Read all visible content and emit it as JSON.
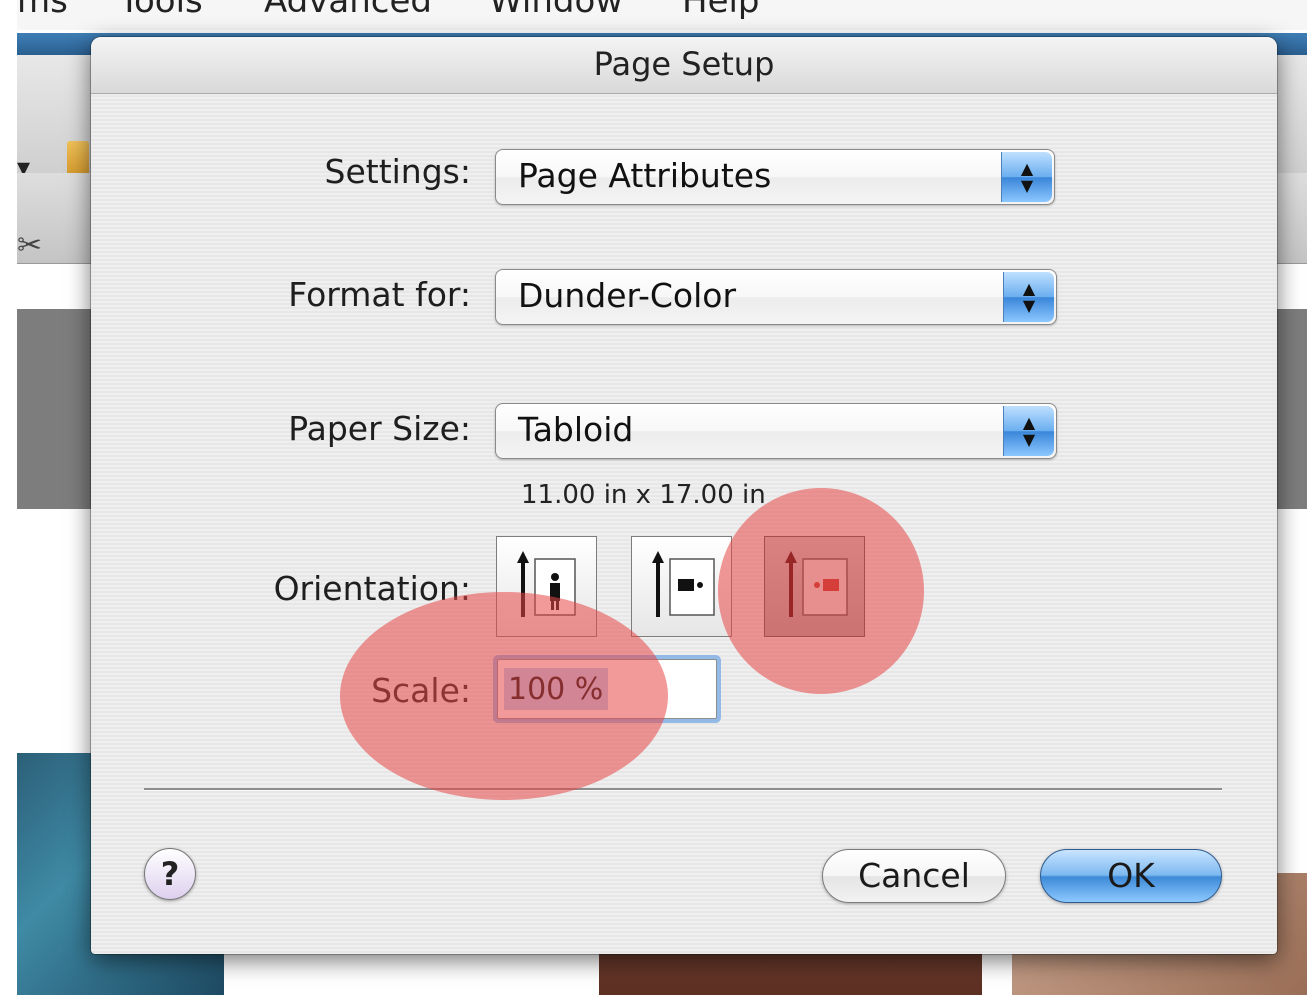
{
  "menubar": {
    "items": [
      "ms",
      "Tools",
      "Advanced",
      "Window",
      "Help"
    ]
  },
  "dialog": {
    "title": "Page Setup",
    "settings": {
      "label": "Settings:",
      "value": "Page Attributes"
    },
    "format_for": {
      "label": "Format for:",
      "value": "Dunder-Color"
    },
    "paper_size": {
      "label": "Paper Size:",
      "value": "Tabloid",
      "dimensions": "11.00 in x 17.00 in"
    },
    "orientation": {
      "label": "Orientation:",
      "options": [
        "portrait-icon",
        "landscape-left-icon",
        "landscape-right-icon"
      ],
      "selected_index": 2
    },
    "scale": {
      "label": "Scale:",
      "value": "100 %"
    },
    "buttons": {
      "help": "?",
      "cancel": "Cancel",
      "ok": "OK"
    }
  },
  "colors": {
    "accent_blue": "#3d8ad8",
    "annotation_red": "#e84646",
    "selected_orientation": "#c0392b"
  }
}
